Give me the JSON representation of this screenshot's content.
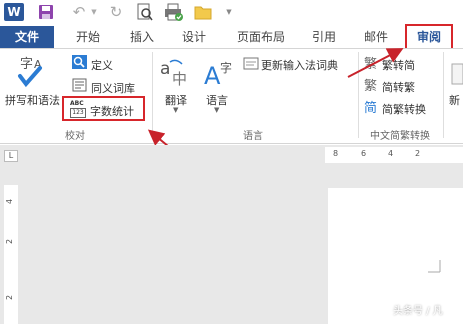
{
  "quick_access": {
    "app_logo": "W",
    "icons": [
      "word-icon",
      "save-icon",
      "undo-icon",
      "redo-icon",
      "print-preview-icon",
      "print-icon",
      "open-folder-icon",
      "customize-icon"
    ]
  },
  "tabs": [
    {
      "id": "file",
      "label": "文件"
    },
    {
      "id": "home",
      "label": "开始"
    },
    {
      "id": "insert",
      "label": "插入"
    },
    {
      "id": "design",
      "label": "设计"
    },
    {
      "id": "layout",
      "label": "页面布局"
    },
    {
      "id": "references",
      "label": "引用"
    },
    {
      "id": "mailings",
      "label": "邮件"
    },
    {
      "id": "review",
      "label": "审阅"
    }
  ],
  "ribbon": {
    "proofing": {
      "spelling_label": "拼写和语法",
      "define_label": "定义",
      "thesaurus_label": "同义词库",
      "word_count_label": "字数统计",
      "abc_badge": "ABC",
      "num_badge": "123",
      "group_label": "校对"
    },
    "language": {
      "translate_label": "翻译",
      "language_label": "语言",
      "ime_label": "更新输入法词典",
      "group_label": "语言"
    },
    "chinese_conversion": {
      "to_simplified": "繁转简",
      "to_traditional": "简转繁",
      "convert": "简繁转换",
      "group_label": "中文简繁转换"
    },
    "next_group_label": "新"
  },
  "ruler": {
    "corner": "L",
    "h_ticks": [
      "8",
      "6",
      "4",
      "2"
    ],
    "v_ticks": [
      "4",
      "2",
      "2"
    ]
  },
  "watermark": "头条号 / 凡",
  "colors": {
    "accent": "#2b579a",
    "highlight": "#d7262b",
    "arrow": "#c8232b"
  }
}
